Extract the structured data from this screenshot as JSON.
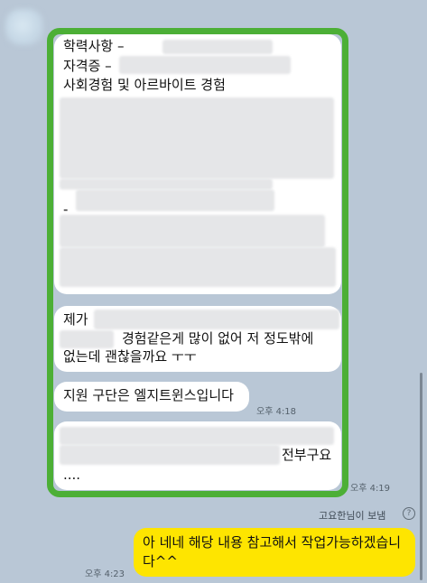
{
  "message1": {
    "line1": "학력사항 –",
    "line2": "자격증 –",
    "line3": "사회경험 및 아르바이트 경험",
    "dash": "-"
  },
  "message2": {
    "line1": "제가",
    "line2": "경험같은게 많이 없어 저 정도밖에",
    "line3": "없는데 괜찮을까요 ㅜㅜ"
  },
  "message3": {
    "text": "지원 구단은 엘지트윈스입니다",
    "time": "오후 4:18"
  },
  "message4": {
    "line1": "전부구요",
    "line2": "....",
    "time": "오후 4:19"
  },
  "read_status": {
    "label": "고요한님이 보냄",
    "icon_glyph": "?"
  },
  "my_message": {
    "line1": "아 네네 해당 내용 참고해서 작업가능하겠습니",
    "line2": "다^^",
    "time": "오후 4:23"
  },
  "colors": {
    "background": "#b9c7d6",
    "highlight": "#4caf36",
    "my_bubble": "#fee500",
    "other_bubble": "#ffffff"
  }
}
